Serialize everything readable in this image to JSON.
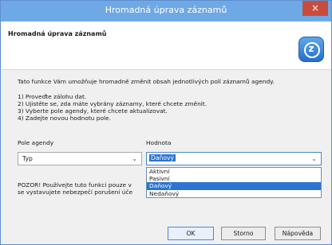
{
  "window": {
    "title": "Hromadná úprava záznamů",
    "close_label": "×"
  },
  "header": {
    "title": "Hromadná úprava záznamů",
    "logo_letter": "z",
    "icon": "brand-logo-icon"
  },
  "body": {
    "description": "Tato funkce Vám umožňuje hromadně změnit obsah jednotlivých polí záznamů agendy.",
    "steps": [
      "1) Proveďte zálohu dat.",
      "2) Ujistěte se, zda máte vybrány záznamy, které chcete změnit.",
      "3) Vyberte pole agendy, které chcete aktualizovat.",
      "4) Zadejte novou hodnotu pole."
    ],
    "field_label": "Pole agendy",
    "field_value": "Typ",
    "value_label": "Hodnota",
    "value_selected": "Daňový",
    "value_options": [
      "Aktivní",
      "Pasivní",
      "Daňový",
      "Nedaňový"
    ],
    "warning_line1": "POZOR! Používejte tuto funkci pouze v",
    "warning_line2": "se vystavujete nebezpečí porušení úče"
  },
  "buttons": {
    "ok": "OK",
    "cancel": "Storno",
    "help": "Nápověda"
  },
  "colors": {
    "titlebar": "#6ea9e6",
    "close": "#c94c3d",
    "selection": "#2d73d2"
  }
}
